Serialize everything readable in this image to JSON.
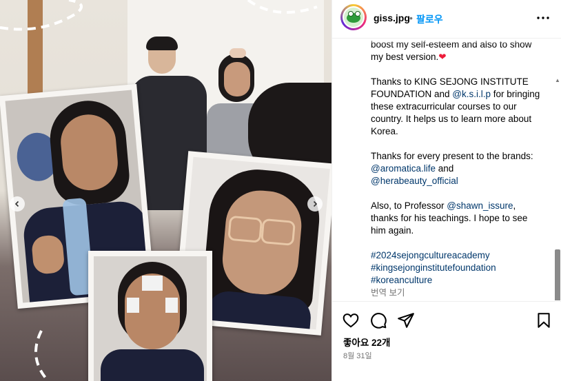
{
  "post": {
    "username": "giss.jpg",
    "separator": "•",
    "follow_label": "팔로우",
    "caption_paragraphs": [
      {
        "text": "boost my self-esteem and also to show my best version.",
        "emoji": "❤️"
      },
      {
        "prefix": "Thanks to KING SEJONG INSTITUTE FOUNDATION and ",
        "mention": "@k.s.i.l.p",
        "suffix": " for bringing these extracurricular courses to our country. It helps us to learn more about Korea."
      },
      {
        "prefix": "Thanks for every present to the brands: ",
        "mention1": "@aromatica.life",
        "mid": " and ",
        "mention2": "@herabeauty_official"
      },
      {
        "prefix": "Also, to Professor ",
        "mention": "@shawn_issure",
        "suffix": ", thanks for his teachings. I hope to see him again."
      }
    ],
    "hashtags": [
      "#2024sejongcultureacademy",
      "#kingsejonginstitutefoundation",
      "#koreanculture"
    ],
    "translate_label": "번역 보기",
    "likes_label": "좋아요 22개",
    "date_label": "8월 31일"
  },
  "icons": {
    "like": "heart-outline-icon",
    "comment": "comment-bubble-icon",
    "share": "paper-plane-icon",
    "save": "bookmark-icon",
    "more": "more-horizontal-icon",
    "prev": "chevron-left-icon",
    "next": "chevron-right-icon"
  },
  "colors": {
    "link": "#00376b",
    "follow": "#0095f6",
    "heart": "#ed1c3a",
    "muted": "#737373"
  }
}
